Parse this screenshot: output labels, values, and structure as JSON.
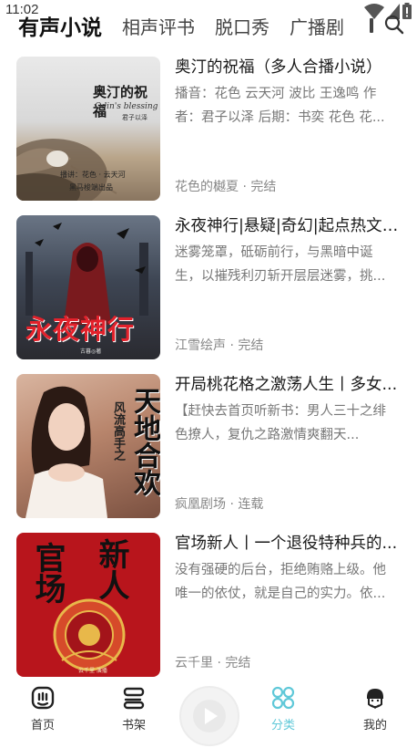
{
  "status": {
    "time": "11:02"
  },
  "tabs": [
    {
      "label": "有声小说",
      "active": true
    },
    {
      "label": "相声评书",
      "active": false
    },
    {
      "label": "脱口秀",
      "active": false
    },
    {
      "label": "广播剧",
      "active": false
    }
  ],
  "books": [
    {
      "title": "奥汀的祝福（多人合播小说）",
      "desc": "播音：花色 云天河 波比 王逸鸣 作者：君子以泽 后期：书奕 花色 花...",
      "meta": "花色的樾夏 · 完结",
      "cover": {
        "title": "奥汀的祝福",
        "subtitle": "Odin's blessing",
        "author": "君子以泽",
        "credit1": "播讲：花色 · 云天河",
        "credit2": "黑马梭端出品"
      }
    },
    {
      "title": "永夜神行|悬疑|奇幻|起点热文|...",
      "desc": "迷雾笼罩，砥砺前行，与黑暗中诞生，以摧残利刃斩开层层迷雾，挑...",
      "meta": "江雪绘声 · 完结",
      "cover": {
        "title": "永夜神行",
        "author": "古暮◎著"
      }
    },
    {
      "title": "开局桃花格之激荡人生丨多女...",
      "desc": "【赶快去首页听新书：男人三十之绯色撩人，复仇之路激情爽翻天...",
      "meta": "疯凰剧场 · 连载",
      "cover": {
        "title": "天地合欢",
        "subtitle": "风流高手之"
      }
    },
    {
      "title": "官场新人丨一个退役特种兵的...",
      "desc": "没有强硬的后台，拒绝贿赂上级。他唯一的依仗，就是自己的实力。依...",
      "meta": "云千里 · 完结",
      "cover": {
        "title": "官场",
        "title2": "新人",
        "author": "云千里 演播"
      }
    }
  ],
  "nav": [
    {
      "label": "首页",
      "icon": "home-icon",
      "active": false
    },
    {
      "label": "书架",
      "icon": "bookshelf-icon",
      "active": false
    },
    {
      "label": "分类",
      "icon": "category-icon",
      "active": true
    },
    {
      "label": "我的",
      "icon": "profile-icon",
      "active": false
    }
  ],
  "colors": {
    "accent": "#5fc8d8",
    "text": "#1a1a1a",
    "subtext": "#777777"
  }
}
